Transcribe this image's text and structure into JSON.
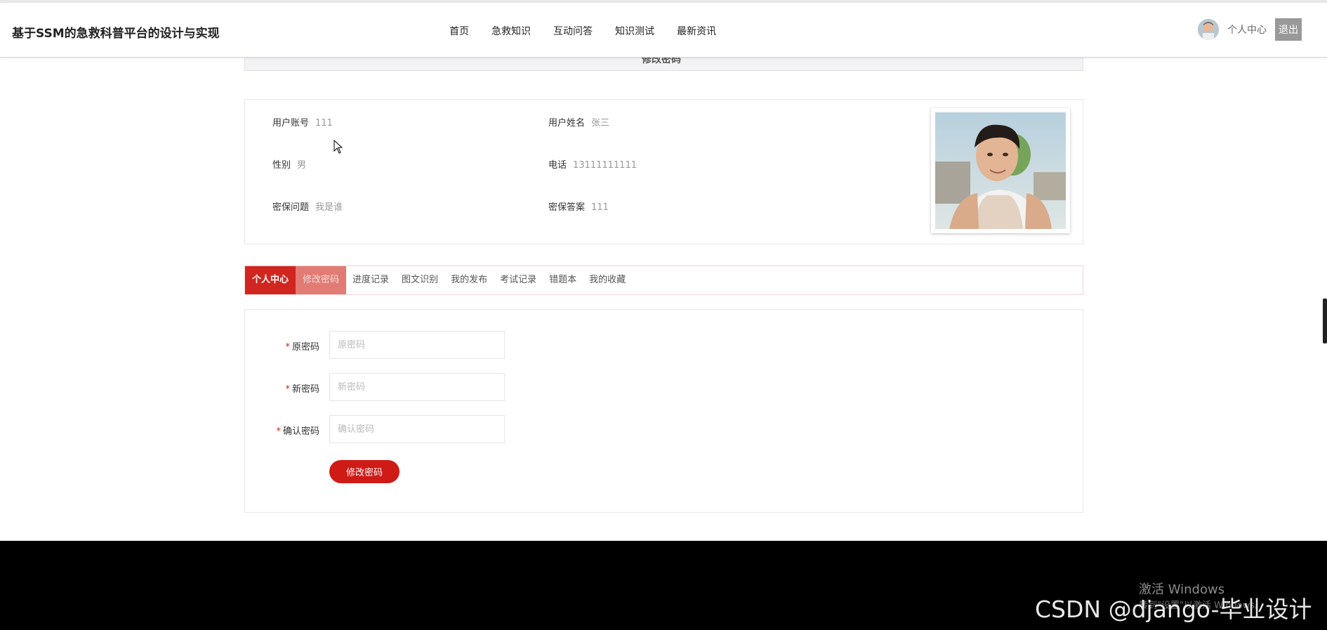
{
  "header": {
    "title": "基于SSM的急救科普平台的设计与实现",
    "nav": [
      "首页",
      "急救知识",
      "互动问答",
      "知识测试",
      "最新资讯"
    ],
    "user_link": "个人中心",
    "logout": "退出"
  },
  "section_bar": {
    "title": "修改密码"
  },
  "profile": {
    "account_label": "用户账号",
    "account_value": "111",
    "name_label": "用户姓名",
    "name_value": "张三",
    "gender_label": "性别",
    "gender_value": "男",
    "phone_label": "电话",
    "phone_value": "13111111111",
    "question_label": "密保问题",
    "question_value": "我是谁",
    "answer_label": "密保答案",
    "answer_value": "111"
  },
  "tabs": {
    "items": [
      "个人中心",
      "修改密码",
      "进度记录",
      "图文识别",
      "我的发布",
      "考试记录",
      "错题本",
      "我的收藏"
    ],
    "active": "个人中心",
    "current": "修改密码"
  },
  "form": {
    "required_mark": "*",
    "old_label": "原密码",
    "old_placeholder": "原密码",
    "new_label": "新密码",
    "new_placeholder": "新密码",
    "confirm_label": "确认密码",
    "confirm_placeholder": "确认密码",
    "submit": "修改密码"
  },
  "watermark": {
    "activate_title": "激活 Windows",
    "activate_sub": "转到\"设置\"以激活 Windows。",
    "csdn": "CSDN @django-毕业设计"
  },
  "colors": {
    "accent": "#d0261f",
    "tab_current_bg": "#e27b74",
    "logout_bg": "#999999",
    "footer_bg": "#000000"
  }
}
